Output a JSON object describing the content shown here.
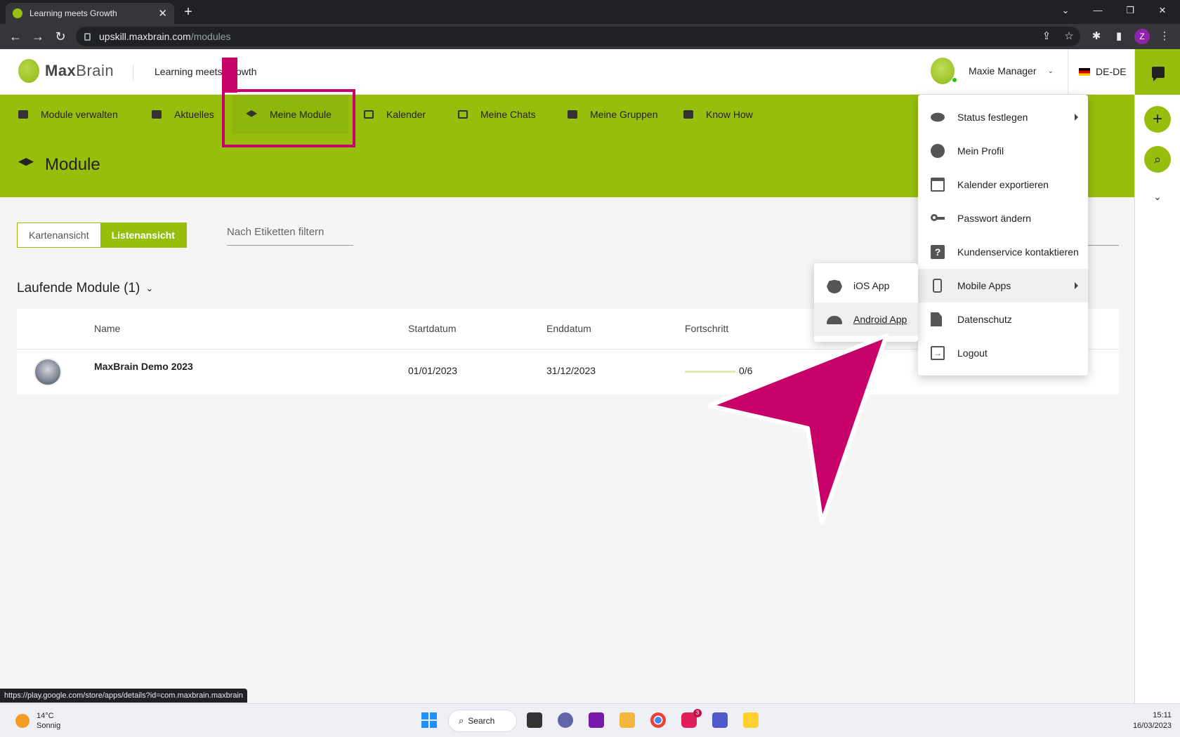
{
  "browser": {
    "tab_title": "Learning meets Growth",
    "tab_close": "✕",
    "new_tab": "+",
    "url_host": "upskill.maxbrain.com",
    "url_path": "/modules",
    "profile_initial": "Z",
    "status_url": "https://play.google.com/store/apps/details?id=com.maxbrain.maxbrain"
  },
  "header": {
    "logo_bold": "Max",
    "logo_light": "Brain",
    "tagline": "Learning meets Growth",
    "user_name": "Maxie Manager",
    "language": "DE-DE"
  },
  "nav": {
    "items": [
      {
        "label": "Module verwalten"
      },
      {
        "label": "Aktuelles"
      },
      {
        "label": "Meine Module"
      },
      {
        "label": "Kalender"
      },
      {
        "label": "Meine Chats"
      },
      {
        "label": "Meine Gruppen"
      },
      {
        "label": "Know How"
      }
    ],
    "active_index": 2
  },
  "page": {
    "title": "Module",
    "view_card": "Kartenansicht",
    "view_list": "Listenansicht",
    "filter_placeholder": "Nach Etiketten filtern",
    "section_title": "Laufende Module (1)"
  },
  "table": {
    "columns": [
      "Name",
      "Startdatum",
      "Enddatum",
      "Fortschritt"
    ],
    "rows": [
      {
        "name": "MaxBrain Demo 2023",
        "start": "01/01/2023",
        "end": "31/12/2023",
        "progress_text": "0/6",
        "progress_fraction": 0
      }
    ]
  },
  "user_menu": {
    "items": [
      {
        "label": "Status festlegen",
        "icon": "eye-icon",
        "has_submenu": true
      },
      {
        "label": "Mein Profil",
        "icon": "account-icon"
      },
      {
        "label": "Kalender exportieren",
        "icon": "calendar-icon"
      },
      {
        "label": "Passwort ändern",
        "icon": "key-icon"
      },
      {
        "label": "Kundenservice kontaktieren",
        "icon": "help-icon"
      },
      {
        "label": "Mobile Apps",
        "icon": "phone-icon",
        "has_submenu": true
      },
      {
        "label": "Datenschutz",
        "icon": "privacy-icon"
      },
      {
        "label": "Logout",
        "icon": "logout-icon"
      }
    ]
  },
  "mobile_submenu": {
    "items": [
      {
        "label": "iOS App",
        "icon": "apple-icon"
      },
      {
        "label": "Android App",
        "icon": "android-icon"
      }
    ]
  },
  "taskbar": {
    "temperature": "14°C",
    "weather": "Sonnig",
    "search_label": "Search",
    "slack_badge": "3",
    "time": "15:11",
    "date": "16/03/2023"
  },
  "colors": {
    "brand_green": "#97be0d",
    "annotation_magenta": "#c8006a"
  }
}
